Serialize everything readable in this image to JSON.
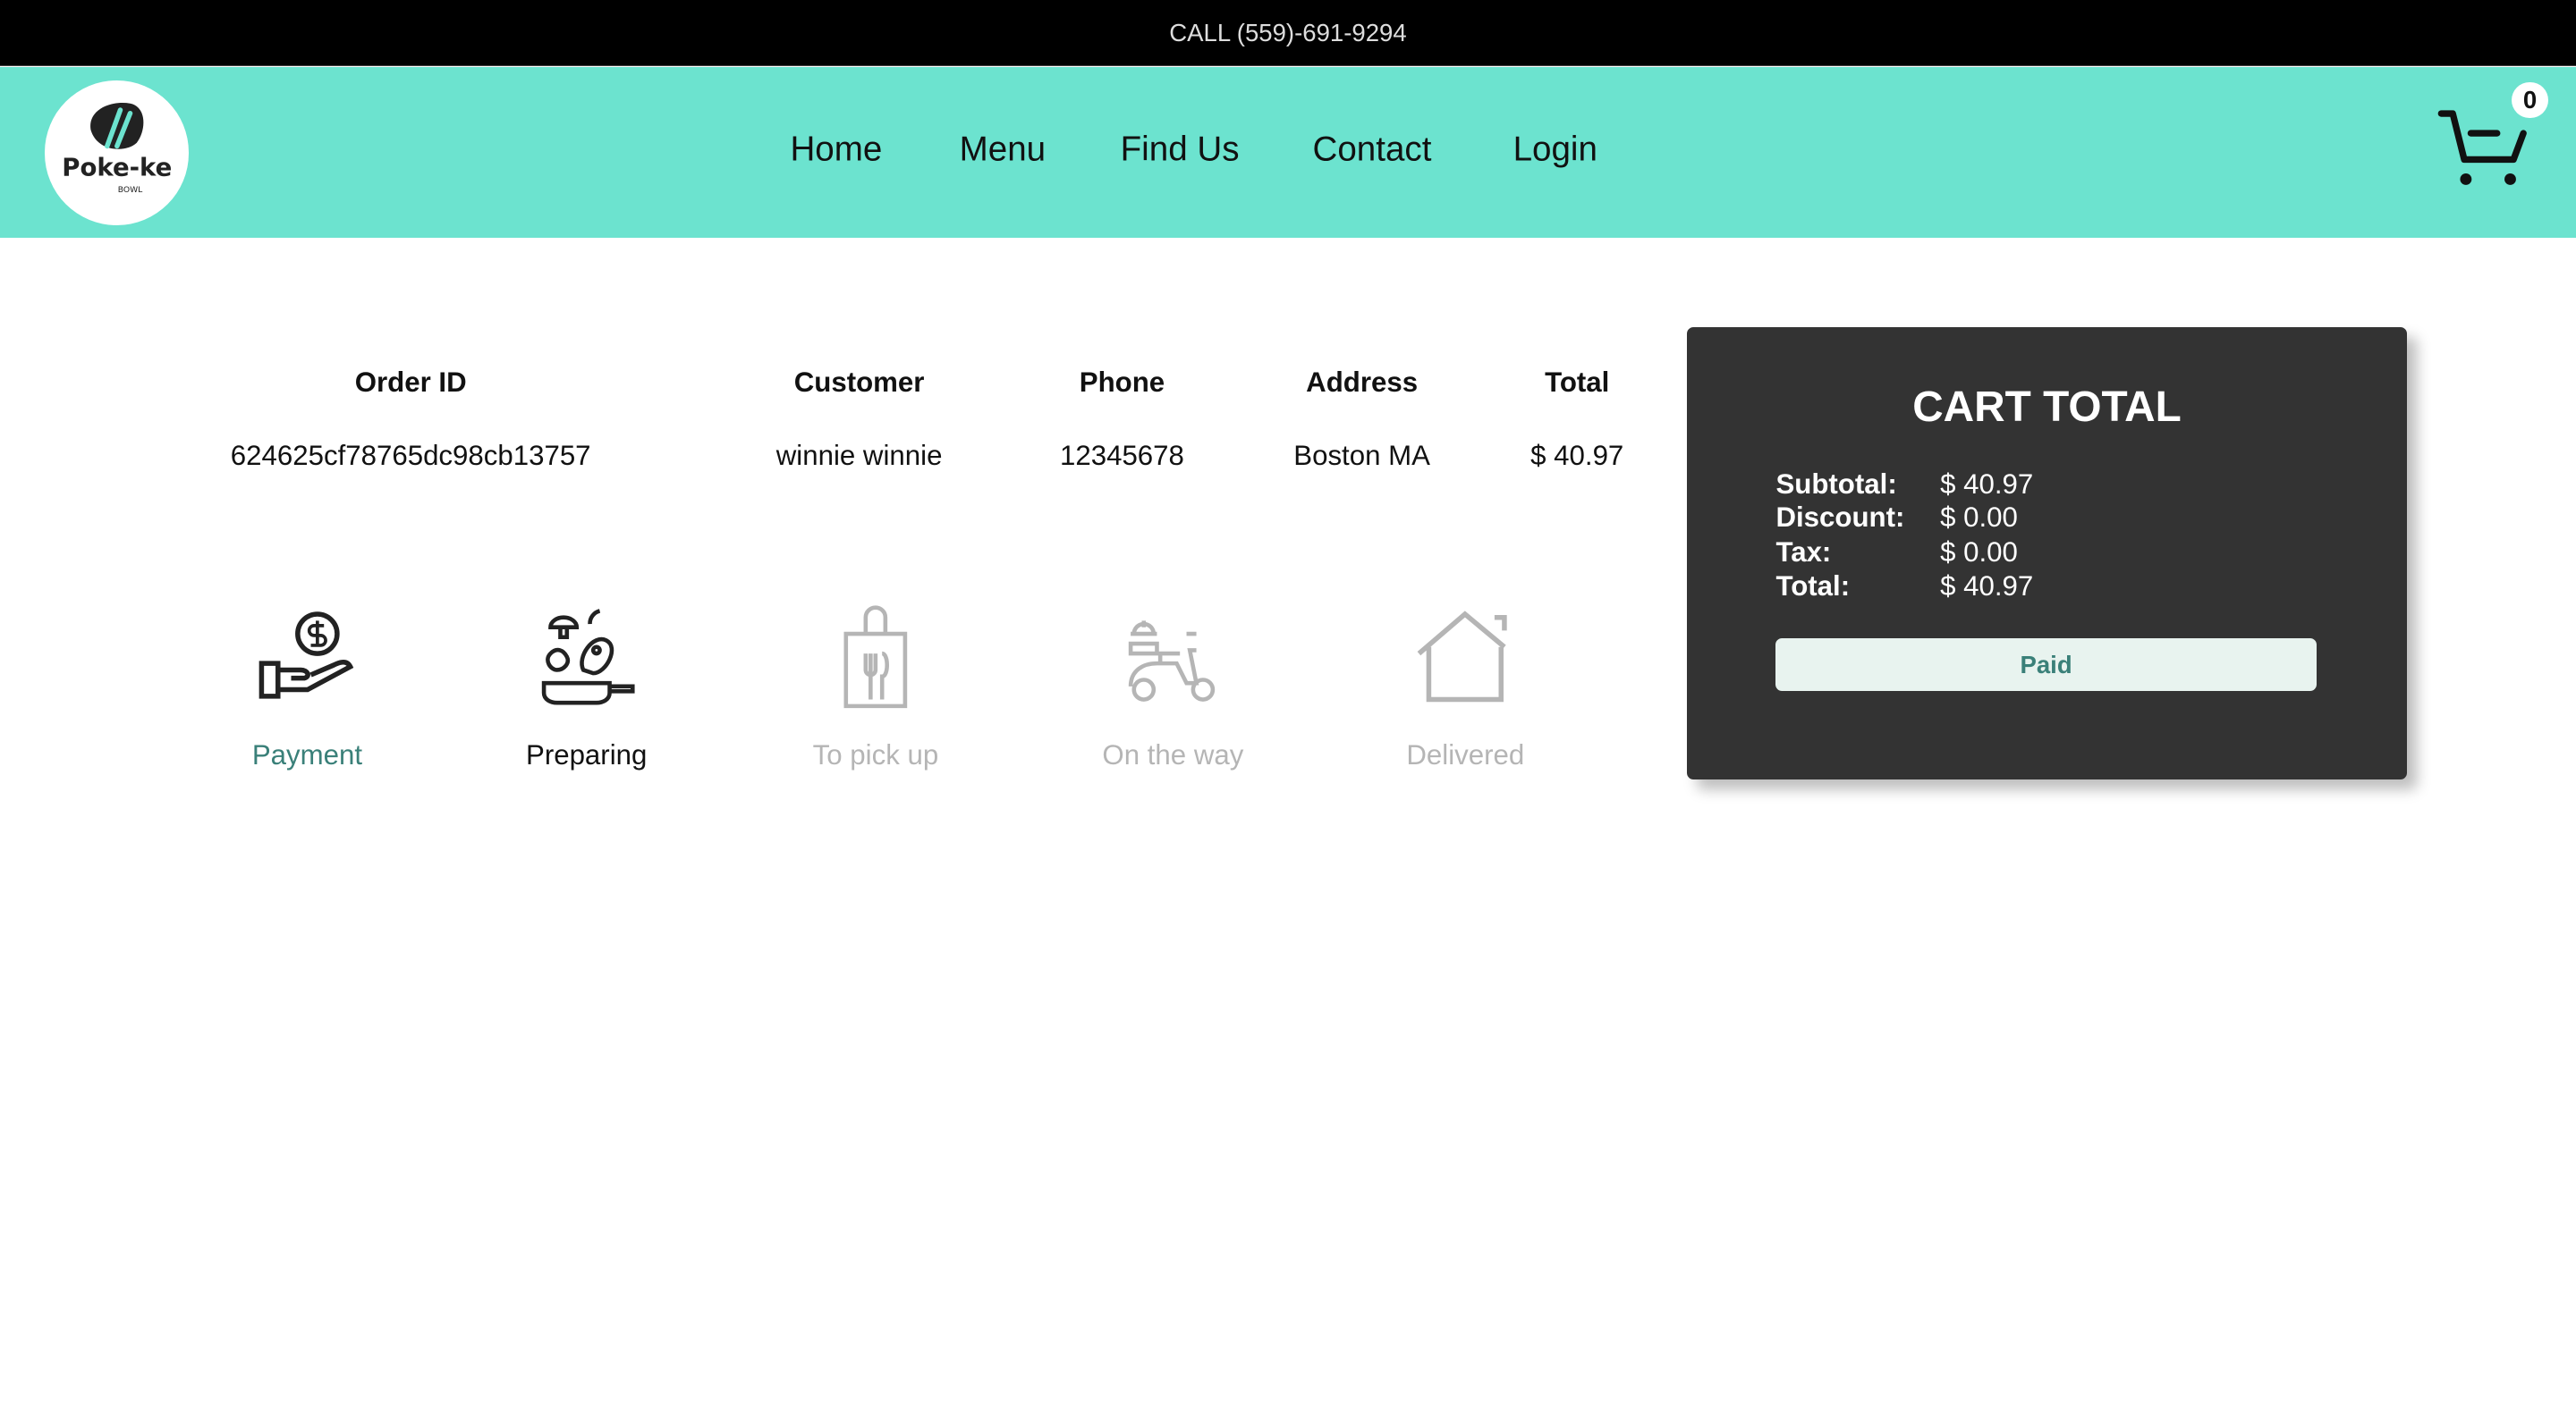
{
  "topbar": {
    "phone": "CALL (559)-691-9294"
  },
  "brand": {
    "name": "Poke-ke",
    "sub": "BOWL"
  },
  "nav": {
    "items": [
      "Home",
      "Menu",
      "Find Us",
      "Contact",
      "Login"
    ]
  },
  "cart": {
    "count": "0"
  },
  "order": {
    "headers": [
      "Order ID",
      "Customer",
      "Phone",
      "Address",
      "Total"
    ],
    "values": [
      "624625cf78765dc98cb13757",
      "winnie winnie",
      "12345678",
      "Boston MA",
      "$ 40.97"
    ]
  },
  "steps": [
    {
      "label": "Payment",
      "icon": "hand-coin-icon",
      "state": "done"
    },
    {
      "label": "Preparing",
      "icon": "cooking-icon",
      "state": "active"
    },
    {
      "label": "To pick up",
      "icon": "bag-icon",
      "state": "pending"
    },
    {
      "label": "On the way",
      "icon": "scooter-icon",
      "state": "pending"
    },
    {
      "label": "Delivered",
      "icon": "house-icon",
      "state": "pending"
    }
  ],
  "summary": {
    "title": "CART TOTAL",
    "rows": [
      {
        "label": "Subtotal:",
        "value": "$ 40.97"
      },
      {
        "label": "Discount:",
        "value": "$ 0.00"
      },
      {
        "label": "Tax:",
        "value": "$ 0.00"
      },
      {
        "label": "Total:",
        "value": "$ 40.97"
      }
    ],
    "button": "Paid"
  },
  "colors": {
    "nav": "#6ce3cf",
    "done": "#3a8079",
    "pending": "#b5b5b5",
    "card": "#333333"
  }
}
